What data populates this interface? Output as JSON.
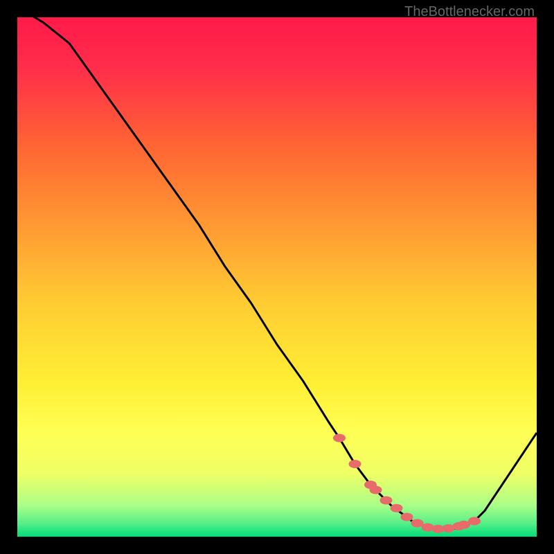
{
  "watermark": "TheBottlenecker.com",
  "chart_data": {
    "type": "line",
    "title": "",
    "xlabel": "",
    "ylabel": "",
    "xlim": [
      0,
      100
    ],
    "ylim": [
      0,
      100
    ],
    "background_gradient_stops": [
      {
        "offset": 0.0,
        "color": "#ff1a4a"
      },
      {
        "offset": 0.1,
        "color": "#ff2e4a"
      },
      {
        "offset": 0.25,
        "color": "#ff6633"
      },
      {
        "offset": 0.4,
        "color": "#ff9933"
      },
      {
        "offset": 0.55,
        "color": "#ffcc33"
      },
      {
        "offset": 0.7,
        "color": "#ffee33"
      },
      {
        "offset": 0.8,
        "color": "#ffff55"
      },
      {
        "offset": 0.88,
        "color": "#eeff66"
      },
      {
        "offset": 0.94,
        "color": "#aaff88"
      },
      {
        "offset": 0.975,
        "color": "#55ee88"
      },
      {
        "offset": 1.0,
        "color": "#00dd77"
      }
    ],
    "series": [
      {
        "name": "bottleneck-curve",
        "x": [
          0,
          5,
          10,
          15,
          20,
          25,
          30,
          35,
          40,
          45,
          50,
          55,
          60,
          62,
          65,
          68,
          72,
          76,
          80,
          84,
          86,
          88,
          90,
          92,
          94,
          96,
          98,
          100
        ],
        "values": [
          102,
          99,
          95,
          88,
          81,
          74,
          67,
          60,
          52,
          45,
          37,
          30,
          22,
          19,
          14,
          10,
          6,
          3,
          1.5,
          1.5,
          2,
          3,
          5,
          8,
          11,
          14,
          17,
          20
        ]
      }
    ],
    "markers": {
      "name": "highlight-range",
      "color": "#e86b6b",
      "x": [
        62,
        65,
        68,
        69,
        71,
        73,
        75,
        77,
        79,
        81,
        83,
        85,
        86,
        88
      ],
      "values": [
        19,
        14,
        10,
        9,
        7,
        5.5,
        3.8,
        2.6,
        1.8,
        1.5,
        1.6,
        2,
        2.3,
        3
      ]
    }
  }
}
